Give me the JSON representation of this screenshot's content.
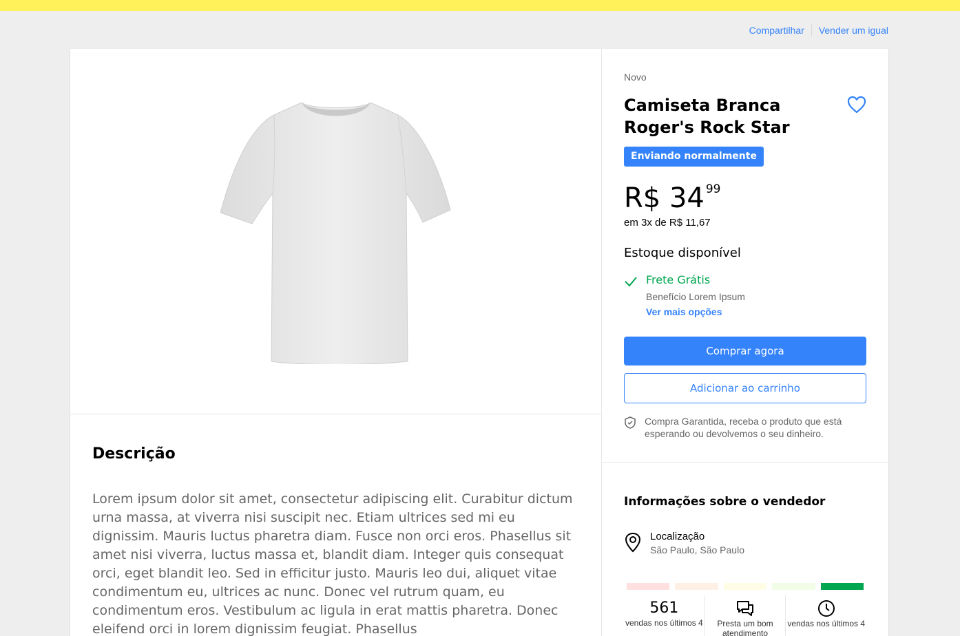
{
  "header": {
    "share_label": "Compartilhar",
    "sell_similar_label": "Vender um igual"
  },
  "colors": {
    "topbar": "#fff159",
    "accent": "#3483fa",
    "success": "#00a650"
  },
  "product": {
    "condition": "Novo",
    "title": "Camiseta Branca Roger's Rock Star",
    "badge": "Enviando normalmente",
    "price_main": "R$ 34",
    "price_cents": "99",
    "installments": "em 3x de R$ 11,67",
    "stock": "Estoque disponível",
    "favorite_icon": "heart-icon"
  },
  "shipping": {
    "title": "Frete Grátis",
    "subtitle": "Benefício Lorem Ipsum",
    "more_link": "Ver mais opções"
  },
  "actions": {
    "buy_now": "Comprar agora",
    "add_to_cart": "Adicionar ao carrinho"
  },
  "guarantee": {
    "text": "Compra Garantida, receba o produto que está esperando ou devolvemos o seu dinheiro."
  },
  "description": {
    "heading": "Descrição",
    "body": "Lorem ipsum dolor sit amet, consectetur adipiscing elit. Curabitur dictum urna massa, at viverra nisi suscipit nec. Etiam ultrices sed mi eu dignissim. Mauris luctus pharetra diam. Fusce non orci eros. Phasellus sit amet nisi viverra, luctus massa et, blandit diam. Integer quis consequat orci, eget blandit leo. Sed in efficitur justo. Mauris leo dui, aliquet vitae condimentum eu, ultrices ac nunc. Donec vel rutrum quam, eu condimentum eros. Vestibulum ac ligula in erat mattis pharetra. Donec eleifend orci in lorem dignissim feugiat. Phasellus"
  },
  "seller": {
    "heading": "Informações sobre o vendedor",
    "location_label": "Localização",
    "location_value": "São Paulo, São Paulo",
    "reputation_colors": [
      "#fee0e0",
      "#fff0e6",
      "#fffde6",
      "#f1fde6",
      "#00a650"
    ],
    "stats": {
      "sales_count": "561",
      "sales_label": "vendas nos últimos 4",
      "service_label": "Presta um bom atendimento",
      "delivery_label": "vendas nos últimos 4"
    }
  }
}
